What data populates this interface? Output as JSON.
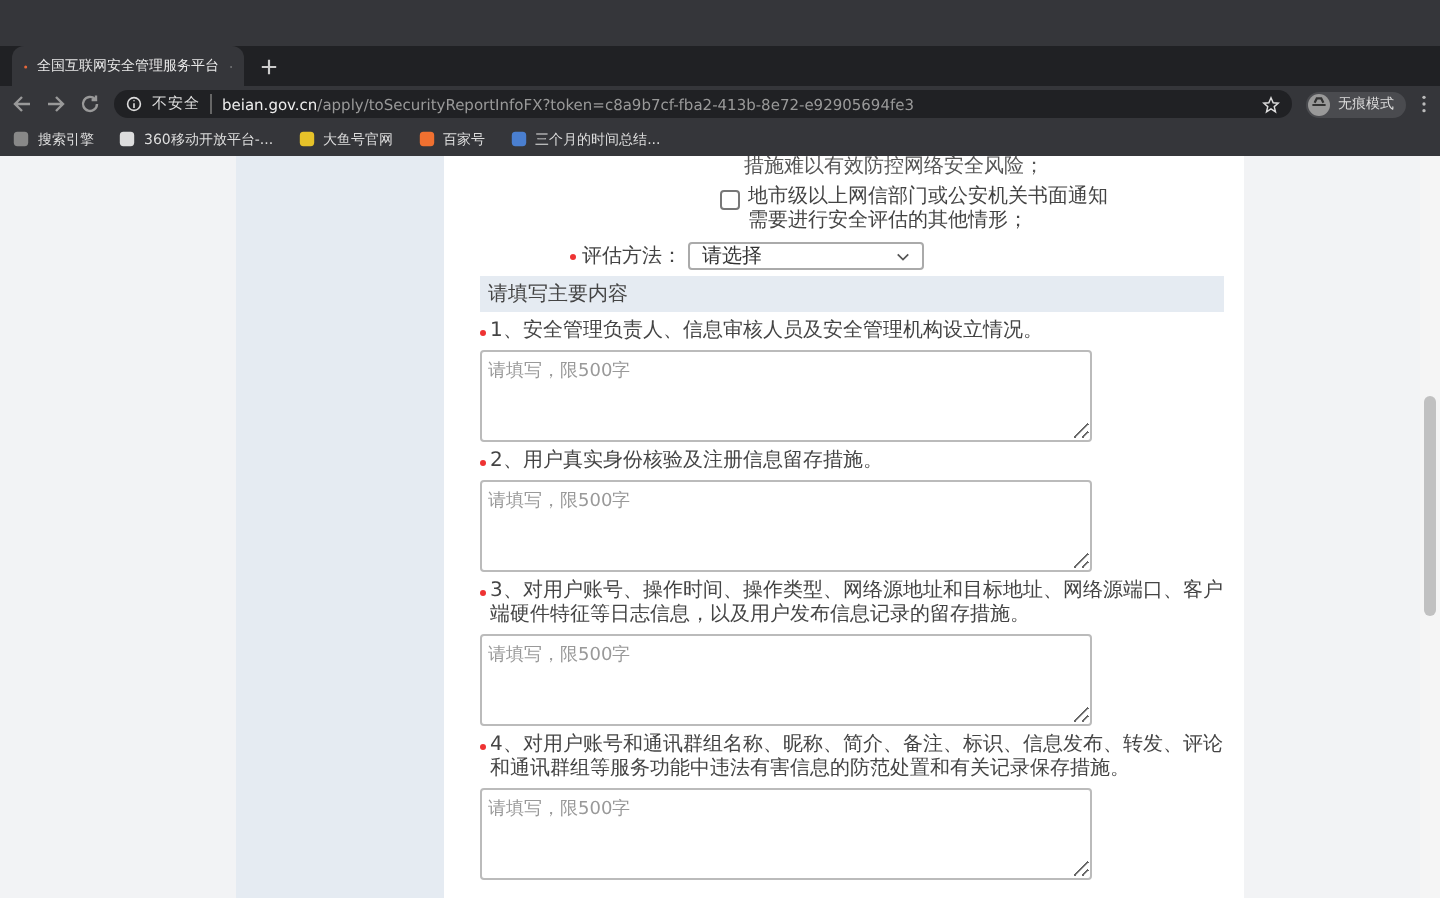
{
  "browser": {
    "tab": {
      "title": "全国互联网安全管理服务平台",
      "selected": true
    },
    "security_label": "不安全",
    "url_host": "beian.gov.cn",
    "url_path": "/apply/toSecurityReportInfoFX?token=c8a9b7cf-fba2-413b-8e72-e92905694fe3",
    "profile": "无痕模式",
    "bookmarks": [
      "搜索引擎",
      "360移动开放平台-...",
      "大鱼号官网",
      "百家号",
      "三个月的时间总结..."
    ]
  },
  "form": {
    "cut_line": "措施难以有效防控网络安全风险；",
    "checkbox": {
      "label": "地市级以上网信部门或公安机关书面通知需要进行安全评估的其他情形；",
      "checked": false
    },
    "method": {
      "label": "评估方法：",
      "value": "请选择",
      "required": true
    },
    "section_title": "请填写主要内容",
    "questions": [
      {
        "label": "1、安全管理负责人、信息审核人员及安全管理机构设立情况。",
        "required": true,
        "placeholder": "请填写，限500字"
      },
      {
        "label": "2、用户真实身份核验及注册信息留存措施。",
        "required": true,
        "placeholder": "请填写，限500字"
      },
      {
        "label": "3、对用户账号、操作时间、操作类型、网络源地址和目标地址、网络源端口、客户端硬件特征等日志信息，以及用户发布信息记录的留存措施。",
        "required": true,
        "placeholder": "请填写，限500字"
      },
      {
        "label": "4、对用户账号和通讯群组名称、昵称、简介、备注、标识、信息发布、转发、评论和通讯群组等服务功能中违法有害信息的防范处置和有关记录保存措施。",
        "required": true,
        "placeholder": "请填写，限500字"
      }
    ]
  }
}
